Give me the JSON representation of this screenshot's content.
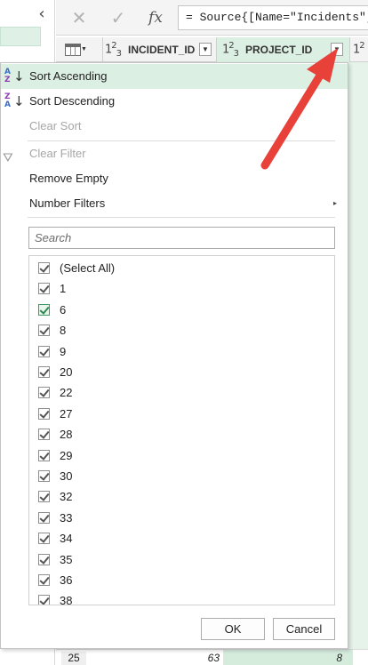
{
  "formula_bar": {
    "cancel_icon": "✕",
    "commit_icon": "✓",
    "fx_label": "fx",
    "formula": "= Source{[Name=\"Incidents\",",
    "colors": {
      "icons": "#b3b3b3"
    }
  },
  "left_pane": {
    "collapse_icon": "‹"
  },
  "columns": {
    "type_icon": "123",
    "incident_id": "INCIDENT_ID",
    "project_id": "PROJECT_ID",
    "partial_type_icon": "12",
    "dropdown_glyph": "▼"
  },
  "menu": {
    "sort_ascending": "Sort Ascending",
    "sort_descending": "Sort Descending",
    "clear_sort": "Clear Sort",
    "clear_filter": "Clear Filter",
    "remove_empty": "Remove Empty",
    "number_filters": "Number Filters",
    "submenu_glyph": "▸",
    "sort_asc_letters": "A Z",
    "sort_desc_letters": "Z A",
    "sort_arrow": "↓"
  },
  "search": {
    "placeholder": "Search"
  },
  "values": [
    "(Select All)",
    "1",
    "6",
    "8",
    "9",
    "20",
    "22",
    "27",
    "28",
    "29",
    "30",
    "32",
    "33",
    "34",
    "35",
    "36",
    "38"
  ],
  "highlighted_value": "6",
  "buttons": {
    "ok": "OK",
    "cancel": "Cancel"
  },
  "bottom_row": {
    "row_number": "25",
    "incident_id": "63",
    "project_id": "8"
  },
  "colors": {
    "hover_highlight": "#dcefe3",
    "selected_column": "#e6f3ea",
    "annotation_arrow": "#e8413a",
    "disabled_text": "#a6a6a6"
  }
}
